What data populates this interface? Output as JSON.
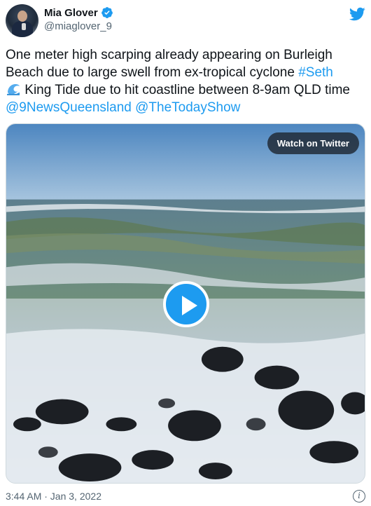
{
  "author": {
    "display_name": "Mia Glover",
    "handle": "@miaglover_9",
    "verified": true
  },
  "tweet": {
    "text_part1": "One meter high scarping already appearing on Burleigh Beach due to large swell from ex-tropical cyclone ",
    "hashtag": "#Seth",
    "text_part2": " King Tide due to hit coastline between 8-9am QLD time ",
    "mention1": "@9NewsQueensland",
    "space": " ",
    "mention2": "@TheTodayShow",
    "timestamp": "3:44 AM · Jan 3, 2022"
  },
  "media": {
    "watch_label": "Watch on Twitter",
    "type": "video"
  },
  "icons": {
    "brand": "twitter-bird-icon",
    "verified": "verified-badge-icon",
    "emoji": "water-wave-icon",
    "play": "play-icon",
    "info": "info-icon"
  },
  "colors": {
    "accent": "#1d9bf0",
    "text": "#0f1419",
    "secondary": "#536471"
  }
}
